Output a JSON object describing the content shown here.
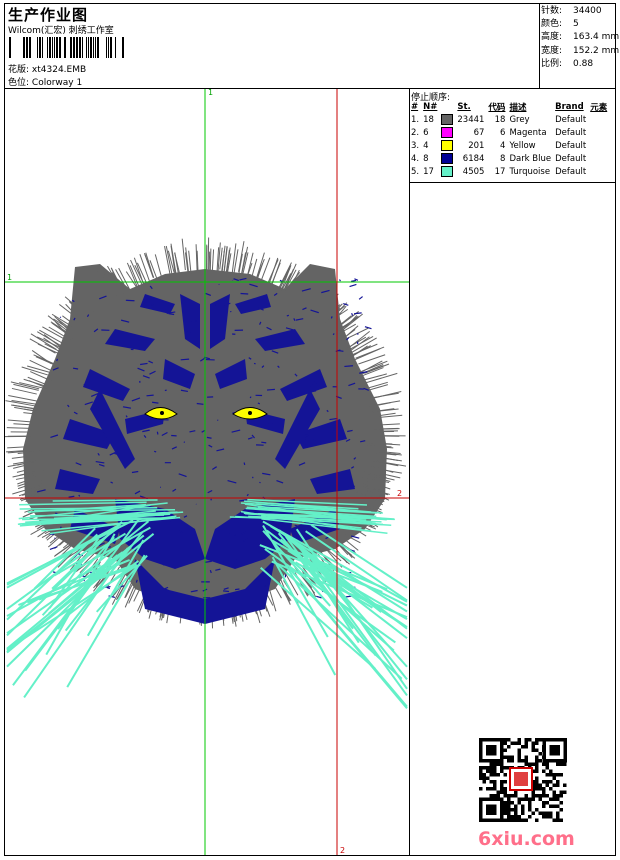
{
  "header": {
    "title": "生产作业图",
    "subtitle": "Wilcom(汇宏) 刺绣工作室",
    "pattern_label": "花版:",
    "pattern_value": "xt4324.EMB",
    "colorway_label": "色位:",
    "colorway_value": "Colorway 1"
  },
  "stats": [
    {
      "label": "针数:",
      "value": "34400"
    },
    {
      "label": "颜色:",
      "value": "5"
    },
    {
      "label": "高度:",
      "value": "163.4 mm"
    },
    {
      "label": "宽度:",
      "value": "152.2 mm"
    },
    {
      "label": "比例:",
      "value": "0.88"
    }
  ],
  "stop_sequence": {
    "title": "停止顺序:",
    "columns": [
      "#",
      "N#",
      "St.",
      "代码",
      "描述",
      "Brand",
      "元素"
    ],
    "rows": [
      {
        "idx": "1.",
        "n": "18",
        "color": "#646464",
        "st": "23441",
        "code": "18",
        "desc": "Grey",
        "brand": "Default"
      },
      {
        "idx": "2.",
        "n": "6",
        "color": "#ff00ff",
        "st": "67",
        "code": "6",
        "desc": "Magenta",
        "brand": "Default"
      },
      {
        "idx": "3.",
        "n": "4",
        "color": "#ffff00",
        "st": "201",
        "code": "4",
        "desc": "Yellow",
        "brand": "Default"
      },
      {
        "idx": "4.",
        "n": "8",
        "color": "#000096",
        "st": "6184",
        "code": "8",
        "desc": "Dark Blue",
        "brand": "Default"
      },
      {
        "idx": "5.",
        "n": "17",
        "color": "#64f0c8",
        "st": "4505",
        "code": "17",
        "desc": "Turquoise",
        "brand": "Default"
      }
    ]
  },
  "axis_labels": {
    "green_v": "1",
    "green_h": "1",
    "red_h": "2",
    "red_v": "2"
  },
  "design_colors": {
    "grey": "#646464",
    "blue": "#141496",
    "yellow": "#ffff00",
    "turquoise": "#64f0c8",
    "green_guide": "#00c800",
    "red_guide": "#c80000"
  },
  "watermark": "6xiu.com"
}
